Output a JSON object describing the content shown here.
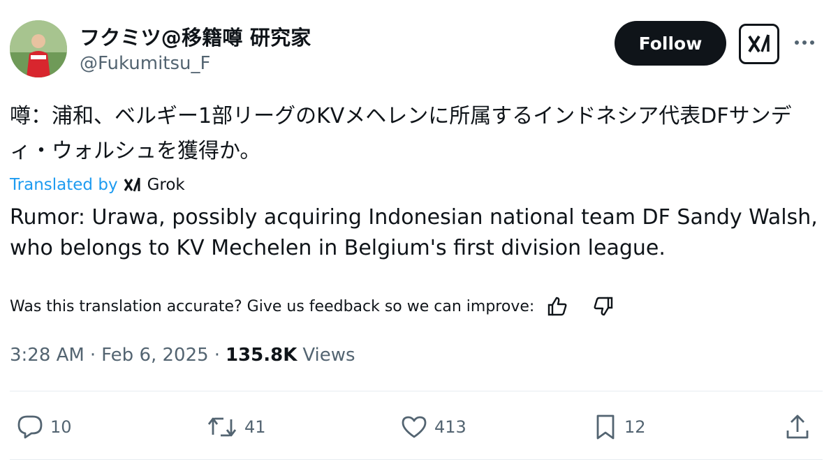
{
  "author": {
    "display_name": "フクミツ@移籍噂 研究家",
    "handle": "@Fukumitsu_F"
  },
  "header": {
    "follow_label": "Follow",
    "grok_icon": "grok-logo-icon",
    "more_icon": "more-horizontal-icon"
  },
  "tweet": {
    "text_jp": "噂：浦和、ベルギー1部リーグのKVメヘレンに所属するインドネシア代表DFサンディ・ウォルシュを獲得か。",
    "translated_by": "Translated by",
    "translator": "Grok",
    "text_en": "Rumor: Urawa, possibly acquiring Indonesian national team DF Sandy Walsh, who belongs to KV Mechelen in Belgium's first division league.",
    "feedback_prompt": "Was this translation accurate? Give us feedback so we can improve:"
  },
  "meta": {
    "time": "3:28 AM",
    "separator": "·",
    "date": "Feb 6, 2025",
    "views_count": "135.8K",
    "views_label": "Views"
  },
  "actions": {
    "replies": "10",
    "reposts": "41",
    "likes": "413",
    "bookmarks": "12"
  },
  "colors": {
    "accent": "#1d9bf0",
    "text": "#0f1419",
    "secondary": "#536471"
  }
}
